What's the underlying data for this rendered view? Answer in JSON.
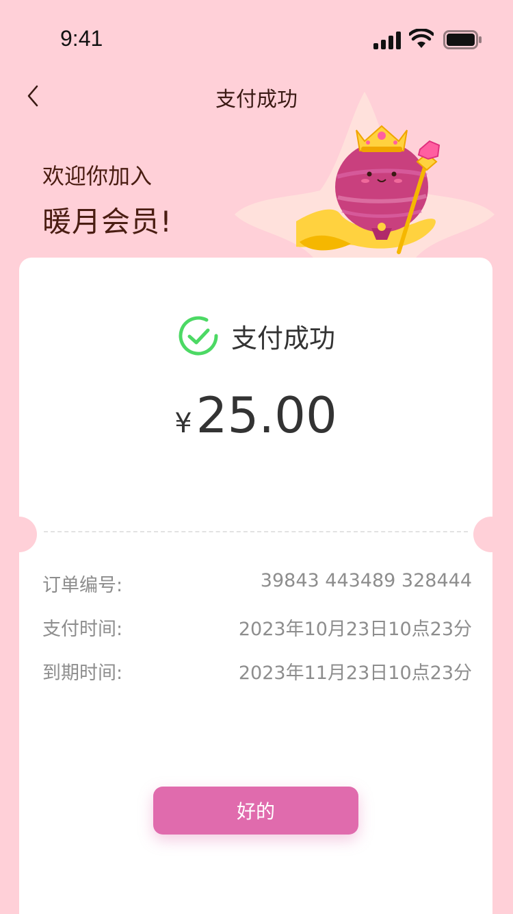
{
  "status_bar": {
    "time": "9:41"
  },
  "nav": {
    "title": "支付成功",
    "back_icon": "chevron-left-icon"
  },
  "hero": {
    "line1": "欢迎你加入",
    "line2": "暖月会员!"
  },
  "card": {
    "status_text": "支付成功",
    "status_icon": "check-circle-icon",
    "currency": "¥",
    "amount": "25.00",
    "details": [
      {
        "label": "订单编号:",
        "value": "39843 443489 328444"
      },
      {
        "label": "支付时间:",
        "value": "2023年10月23日10点23分"
      },
      {
        "label": "到期时间:",
        "value": "2023年11月23日10点23分"
      }
    ],
    "ok_label": "好的"
  },
  "colors": {
    "background": "#ffd0d8",
    "accent": "#e06bad",
    "success": "#4cd964",
    "text_dark": "#333333",
    "text_muted": "#8d8d8d"
  }
}
